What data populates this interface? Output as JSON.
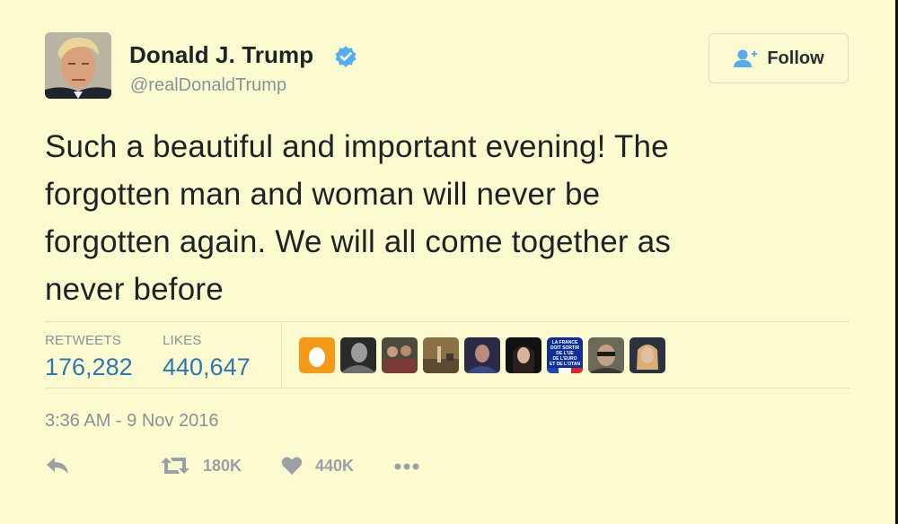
{
  "user": {
    "name": "Donald J. Trump",
    "handle": "@realDonaldTrump",
    "verified": true
  },
  "follow_button": {
    "label": "Follow",
    "icon": "follow-user-icon"
  },
  "tweet": {
    "lines": [
      "Such a beautiful and important evening! The",
      "forgotten man and woman will never be",
      "forgotten again. We will all come together as",
      "never before"
    ]
  },
  "stats": {
    "retweets_label": "RETWEETS",
    "retweets_value": "176,282",
    "likes_label": "LIKES",
    "likes_value": "440,647"
  },
  "liker_avatars": [
    "default-egg-avatar",
    "grayscale-portrait-avatar",
    "group-photo-avatar",
    "room-interior-avatar",
    "dark-portrait-avatar",
    "long-hair-portrait-avatar",
    "la-france-flag-avatar",
    "sunglasses-portrait-avatar",
    "blonde-portrait-avatar"
  ],
  "liker_flag_text": [
    "LA FRANCE",
    "DOIT SORTIR",
    "DE L'UE",
    "DE L'EURO",
    "ET DE L'OTAN"
  ],
  "timestamp": "3:36 AM - 9 Nov 2016",
  "actions": {
    "reply_icon": "reply-icon",
    "retweet_icon": "retweet-icon",
    "retweet_count": "180K",
    "like_icon": "heart-icon",
    "like_count": "440K",
    "more_icon": "more-icon"
  },
  "colors": {
    "background": "#fcfbcf",
    "verified_blue": "#55acee",
    "stat_blue": "#2a78b8",
    "muted": "#8a9199"
  }
}
